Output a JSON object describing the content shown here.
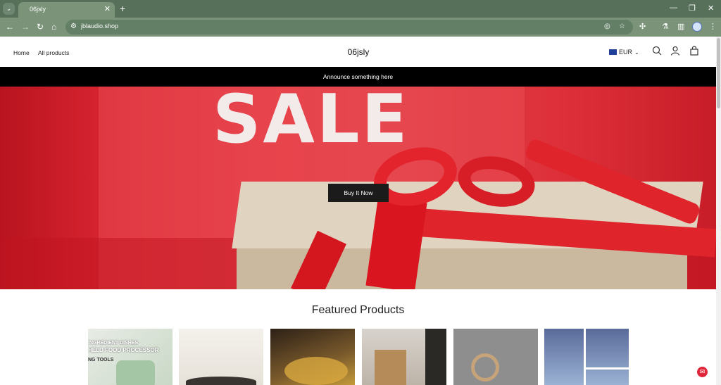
{
  "browser": {
    "tab_title": "06jsly",
    "url": "jblaudio.shop"
  },
  "header": {
    "nav": [
      {
        "label": "Home"
      },
      {
        "label": "All products"
      }
    ],
    "store_name": "06jsly",
    "currency": "EUR"
  },
  "announcement": "Announce something here",
  "hero": {
    "sale_text": "SALE",
    "button_label": "Buy It Now"
  },
  "featured": {
    "title": "Featured Products",
    "product_image_text": [
      "INGREDIENT DISHES",
      "HELD FOOD PROCESSOR",
      "NG TOOLS"
    ]
  }
}
